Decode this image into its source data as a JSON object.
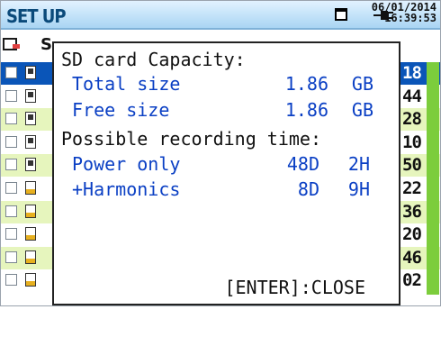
{
  "header": {
    "title": "SET UP",
    "date": "06/01/2014",
    "time": "16:39:53"
  },
  "list": {
    "header_letter": "S",
    "rows": [
      {
        "num": "18",
        "style": "blue",
        "icon": "pc"
      },
      {
        "num": "44",
        "style": "white",
        "icon": "pc"
      },
      {
        "num": "28",
        "style": "green",
        "icon": "pc"
      },
      {
        "num": "10",
        "style": "white",
        "icon": "pc"
      },
      {
        "num": "50",
        "style": "green",
        "icon": "pc"
      },
      {
        "num": "22",
        "style": "white",
        "icon": "doc"
      },
      {
        "num": "36",
        "style": "green",
        "icon": "doc"
      },
      {
        "num": "20",
        "style": "white",
        "icon": "doc"
      },
      {
        "num": "46",
        "style": "green",
        "icon": "doc"
      },
      {
        "num": "02",
        "style": "white",
        "icon": "doc"
      }
    ]
  },
  "dialog": {
    "title": "SD card Capacity:",
    "total_label": "Total size",
    "total_value": "1.86",
    "total_unit": "GB",
    "free_label": "Free size",
    "free_value": "1.86",
    "free_unit": "GB",
    "recording_title": "Possible recording time:",
    "power_label": "Power only",
    "power_days": "48D",
    "power_hours": "2H",
    "harm_label": "+Harmonics",
    "harm_days": "8D",
    "harm_hours": "9H",
    "close_hint": "[ENTER]:CLOSE"
  },
  "colors": {
    "accent_blue": "#0a3fc4",
    "selected_row": "#0a55b8",
    "alt_row": "#e6f5bd",
    "scrollbar": "#7ccd3c",
    "header_gradient_top": "#e2f2ff",
    "header_gradient_bottom": "#a9d5f3"
  },
  "icons": {
    "card": "sd-card-icon",
    "power": "power-plug-icon",
    "folder": "folder-icon"
  }
}
